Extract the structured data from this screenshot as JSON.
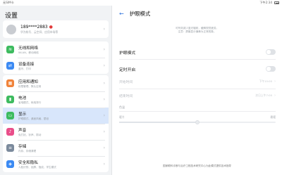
{
  "status": {
    "carrier": "无SIM卡",
    "time": "下午2:34"
  },
  "left": {
    "title": "设置",
    "profile": {
      "name": "189****2883",
      "sub": "华为帐号、云空间、应用市场等"
    },
    "menu_groups": [
      [
        {
          "title": "无线和网络",
          "sub": "WLAN、移动网络",
          "icon": "wifi-icon",
          "color": "#3dbb5f"
        },
        {
          "title": "设备连接",
          "sub": "蓝牙、打印",
          "icon": "device-connect-icon",
          "color": "#3b8af3"
        }
      ],
      [
        {
          "title": "应用和通知",
          "sub": "权限管理、默认应用",
          "icon": "apps-icon",
          "color": "#f0833a"
        },
        {
          "title": "电池",
          "sub": "省电模式、耗电排行",
          "icon": "battery-icon",
          "color": "#3dbb5f"
        },
        {
          "title": "显示",
          "sub": "护眼模式、桌面风格、壁纸",
          "icon": "display-icon",
          "color": "#3dbb5f",
          "active": true
        },
        {
          "title": "声音",
          "sub": "免打扰、铃声、振动",
          "icon": "sound-icon",
          "color": "#e94e8a"
        },
        {
          "title": "存储",
          "sub": "内存、存储清理",
          "icon": "storage-icon",
          "color": "#7b8a9c"
        },
        {
          "title": "安全和隐私",
          "sub": "人脸识别、锁屏、指纹、学生模式",
          "icon": "security-icon",
          "color": "#3b8af3"
        }
      ]
    ]
  },
  "right": {
    "title": "护眼模式",
    "desc1": "可有效减少蓝光辐射，缓解视觉疲劳。",
    "desc2": "注意：屏幕显示偏黄为正常现象。",
    "eye_mode_label": "护眼模式",
    "scheduled_label": "定时开启",
    "start_label": "开始时间",
    "start_value": "下午10:00",
    "end_label": "结束时间",
    "end_value": "次日上午7:00",
    "section_label": "色温",
    "slider_left": "暖冷",
    "slider_right": "最暖",
    "footer": "国家眼科诊断与治疗工程技术研究中心为此模式提供技术指导"
  }
}
